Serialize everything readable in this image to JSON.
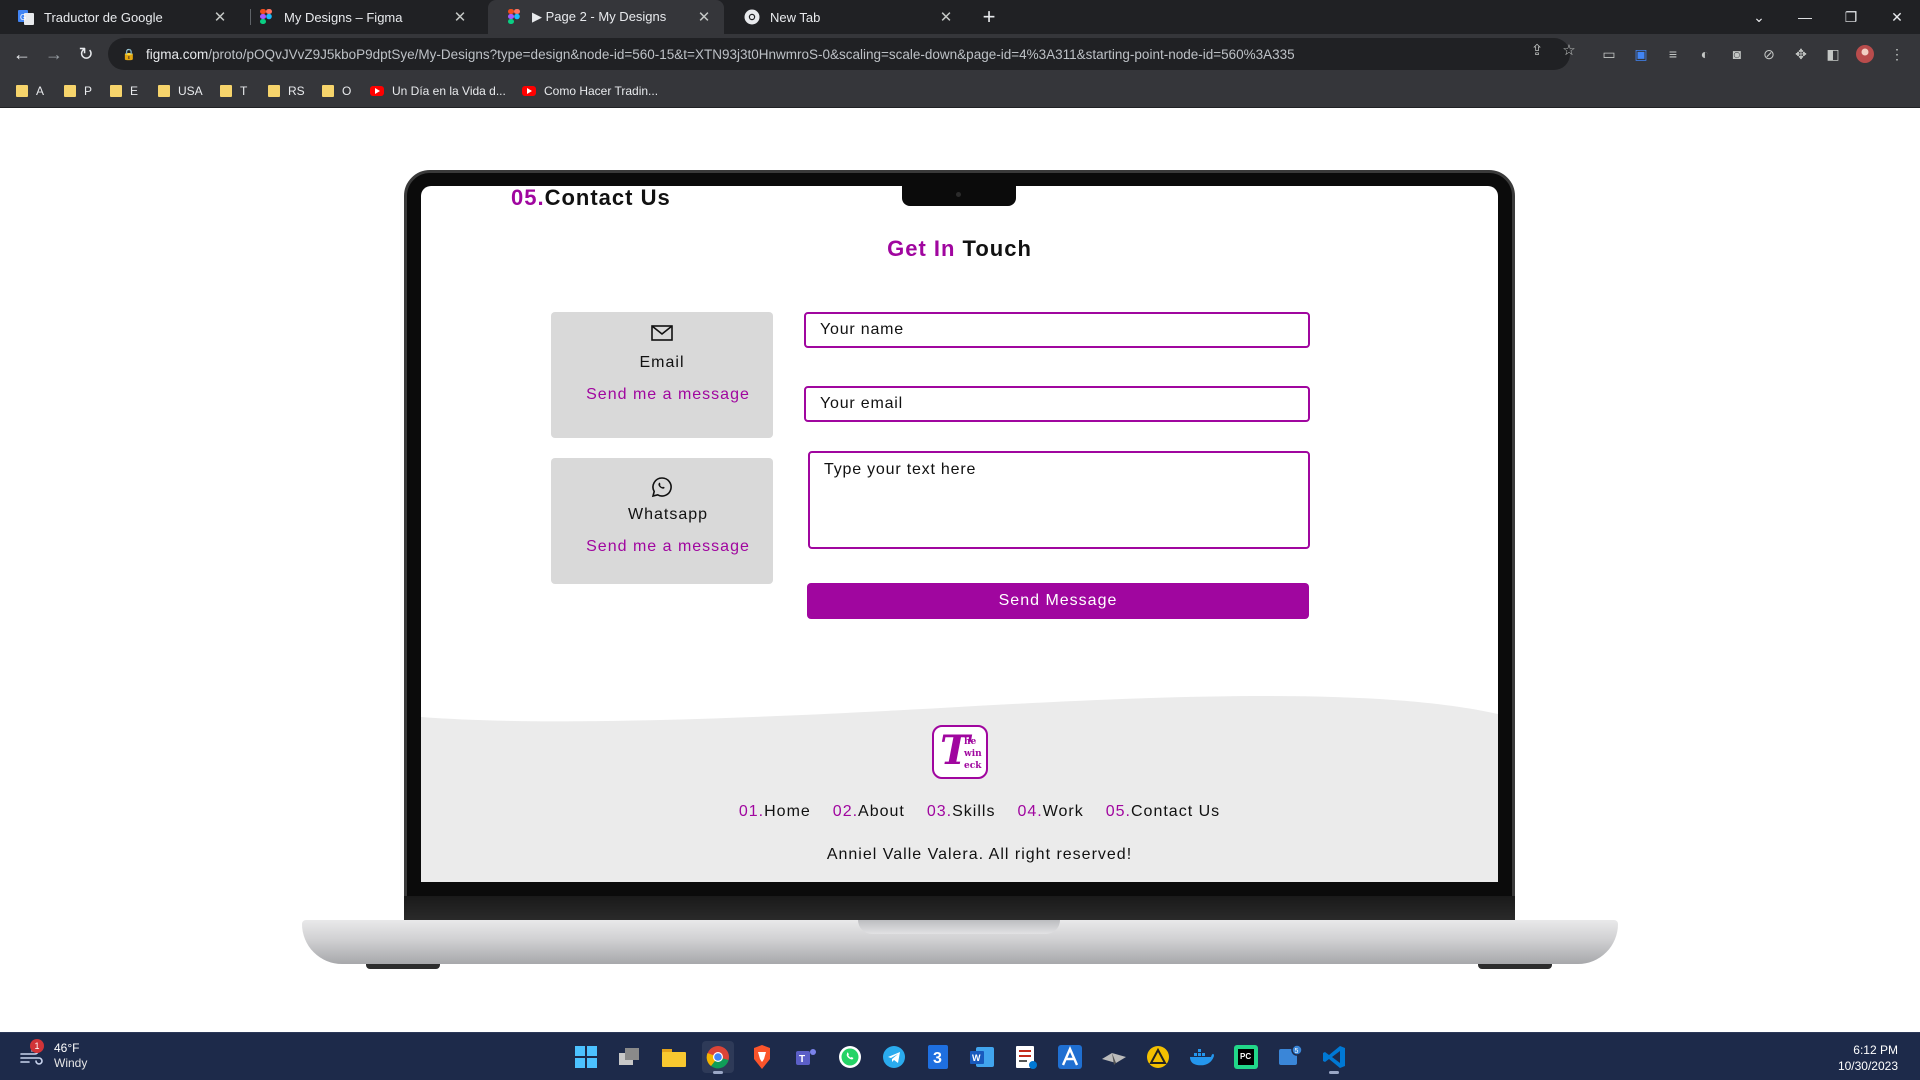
{
  "browser": {
    "tabs": [
      {
        "title": "Traductor de Google",
        "favicon": "google-translate-icon",
        "active": false
      },
      {
        "title": "My Designs – Figma",
        "favicon": "figma-icon",
        "active": false
      },
      {
        "title": "▶ Page 2 - My Designs",
        "favicon": "figma-icon",
        "active": true
      },
      {
        "title": "New Tab",
        "favicon": "chrome-icon",
        "active": false
      }
    ],
    "url_host": "figma.com",
    "url_path": "/proto/pOQvJVvZ9J5kboP9dptSye/My-Designs?type=design&node-id=560-15&t=XTN93j3t0HnwmroS-0&scaling=scale-down&page-id=4%3A311&starting-point-node-id=560%3A335",
    "bookmarks": [
      {
        "label": "A",
        "type": "folder"
      },
      {
        "label": "P",
        "type": "folder"
      },
      {
        "label": "E",
        "type": "folder"
      },
      {
        "label": "USA",
        "type": "folder"
      },
      {
        "label": "T",
        "type": "folder"
      },
      {
        "label": "RS",
        "type": "folder"
      },
      {
        "label": "O",
        "type": "folder"
      },
      {
        "label": "Un Día en la Vida d...",
        "type": "youtube"
      },
      {
        "label": "Como Hacer Tradin...",
        "type": "youtube"
      }
    ]
  },
  "site": {
    "section": {
      "number": "05.",
      "title": "Contact Us"
    },
    "heading": {
      "accent": "Get In",
      "rest": " Touch"
    },
    "cards": [
      {
        "title": "Email",
        "link": "Send me a message",
        "icon": "envelope-icon"
      },
      {
        "title": "Whatsapp",
        "link": "Send me a message",
        "icon": "whatsapp-icon"
      }
    ],
    "form": {
      "name_placeholder": "Your name",
      "email_placeholder": "Your email",
      "message_placeholder": "Type your text here",
      "submit": "Send Message"
    },
    "footer": {
      "logo_letters": [
        "T",
        "he",
        "win",
        "eck"
      ],
      "nav": [
        {
          "num": "01.",
          "label": "Home"
        },
        {
          "num": "02.",
          "label": "About"
        },
        {
          "num": "03.",
          "label": "Skills"
        },
        {
          "num": "04.",
          "label": "Work"
        },
        {
          "num": "05.",
          "label": "Contact Us"
        }
      ],
      "copyright": "Anniel Valle Valera. All right reserved!"
    },
    "accent_color": "#a0069f"
  },
  "taskbar": {
    "weather": {
      "temp": "46°F",
      "condition": "Windy",
      "badge": "1"
    },
    "apps": [
      "windows-start-icon",
      "task-view-icon",
      "file-explorer-icon",
      "chrome-icon",
      "brave-icon",
      "teams-icon",
      "whatsapp-icon",
      "telegram-icon",
      "3-app-icon",
      "word-icon",
      "snipping-tool-icon",
      "vector-app-icon",
      "dark-app-icon",
      "warning-app-icon",
      "docker-icon",
      "pycharm-icon",
      "taskbar-app-icon",
      "vscode-icon"
    ],
    "app_badge": "5",
    "time": "6:12 PM",
    "date": "10/30/2023"
  }
}
